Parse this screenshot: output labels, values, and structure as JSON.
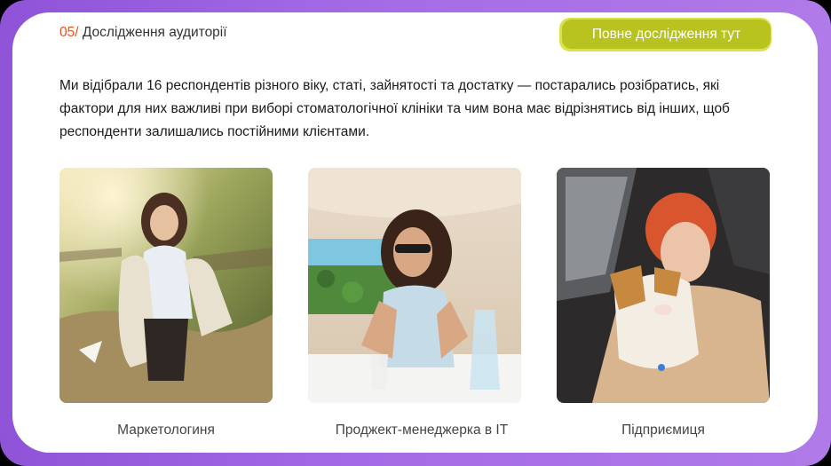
{
  "header": {
    "section_number": "05/",
    "section_title": "Дослідження аудиторії",
    "cta_label": "Повне дослідження тут"
  },
  "intro_text": "Ми відібрали 16 респондентів різного віку, статі, зайнятості та достатку — постарались розібратись, які фактори для них важливі при виборі стоматологічної клініки та чим вона має відрізнятись від інших, щоб респонденти залишались постійними клієнтами.",
  "personas": [
    {
      "caption": "Маркетологиня",
      "photo": "woman-in-park-photo"
    },
    {
      "caption": "Проджект-менеджерка в IT",
      "photo": "woman-in-sunglasses-cafe-photo"
    },
    {
      "caption": "Підприємиця",
      "photo": "woman-with-dog-in-car-photo"
    }
  ],
  "colors": {
    "frame_purple": "#a56be6",
    "section_number_orange": "#e8511f",
    "cta_green": "#b8c320",
    "cta_glow": "#d9e24a"
  }
}
